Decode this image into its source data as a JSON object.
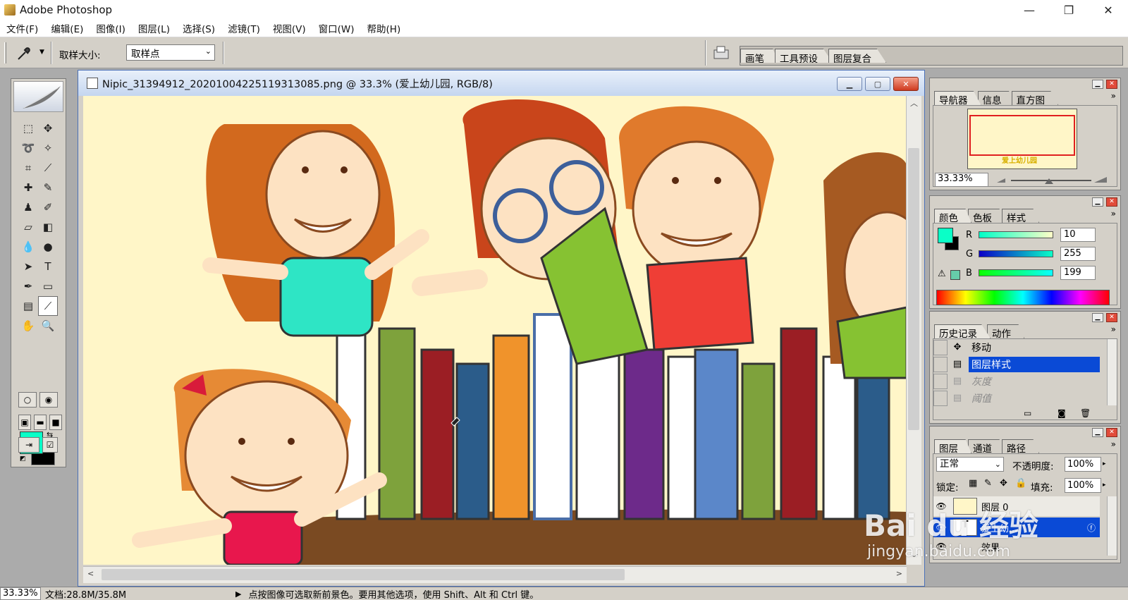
{
  "window": {
    "title": "Adobe Photoshop",
    "minimize": "—",
    "maximize": "❐",
    "close": "✕"
  },
  "menu": [
    "文件(F)",
    "编辑(E)",
    "图像(I)",
    "图层(L)",
    "选择(S)",
    "滤镜(T)",
    "视图(V)",
    "窗口(W)",
    "帮助(H)"
  ],
  "options": {
    "sample_size_label": "取样大小:",
    "sample_size_value": "取样点"
  },
  "palette_well_tabs": [
    "画笔",
    "工具预设",
    "图层复合"
  ],
  "document": {
    "title": "Nipic_31394912_20201004225119313085.png @ 33.3% (爱上幼儿园, RGB/8)",
    "colors": {
      "background": "#fff6c8"
    }
  },
  "navigator": {
    "tabs": [
      "导航器",
      "信息",
      "直方图"
    ],
    "zoom": "33.33%",
    "thumb_caption": "爱上幼儿园"
  },
  "color_panel": {
    "tabs": [
      "颜色",
      "色板",
      "样式"
    ],
    "foreground": "#0affc7",
    "r_label": "R",
    "r_value": "10",
    "g_label": "G",
    "g_value": "255",
    "b_label": "B",
    "b_value": "199"
  },
  "history": {
    "tabs": [
      "历史记录",
      "动作"
    ],
    "items": [
      {
        "label": "移动",
        "icon": "move-icon"
      },
      {
        "label": "图层样式",
        "icon": "layer-style-icon"
      },
      {
        "label": "灰度",
        "icon": "grayscale-icon"
      },
      {
        "label": "阈值",
        "icon": "threshold-icon"
      }
    ]
  },
  "layers": {
    "tabs": [
      "图层",
      "通道",
      "路径"
    ],
    "blend_mode": "正常",
    "opacity_label": "不透明度:",
    "opacity_value": "100%",
    "lock_label": "锁定:",
    "fill_label": "填充:",
    "fill_value": "100%",
    "items": [
      {
        "name": "图层 0"
      },
      {
        "name": "爱上幼..."
      },
      {
        "name": "效果"
      }
    ]
  },
  "status": {
    "zoom": "33.33%",
    "doc_info": "文档:28.8M/35.8M",
    "hint": "点按图像可选取新前景色。要用其他选项，使用 Shift、Alt 和 Ctrl 键。"
  },
  "watermark": {
    "main": "Bai du 经验",
    "sub": "jingyan.baidu.com"
  }
}
